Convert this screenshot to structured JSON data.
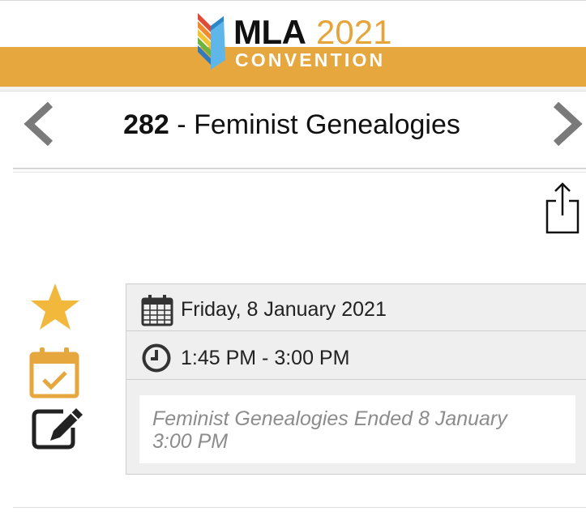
{
  "header": {
    "logo_mla": "MLA",
    "logo_year": "2021",
    "logo_convention": "CONVENTION",
    "brand_color": "#e5a73e"
  },
  "session": {
    "number": "282",
    "separator": " - ",
    "title": "Feminist Genealogies"
  },
  "details": {
    "date": "Friday, 8 January 2021",
    "time": "1:45 PM - 3:00 PM",
    "note_line1": "Feminist Genealogies Ended 8 January",
    "note_line2": "3:00 PM"
  },
  "icons": {
    "prev": "chevron-left-icon",
    "next": "chevron-right-icon",
    "share": "share-icon",
    "favorite": "star-icon",
    "schedule": "calendar-check-icon",
    "notes": "edit-icon",
    "date": "calendar-icon",
    "time": "clock-icon"
  },
  "colors": {
    "accent_orange": "#e5a73e",
    "star_yellow": "#f2b83b",
    "panel_bg": "#efefef",
    "nav_arrow": "#7a7a7a"
  }
}
